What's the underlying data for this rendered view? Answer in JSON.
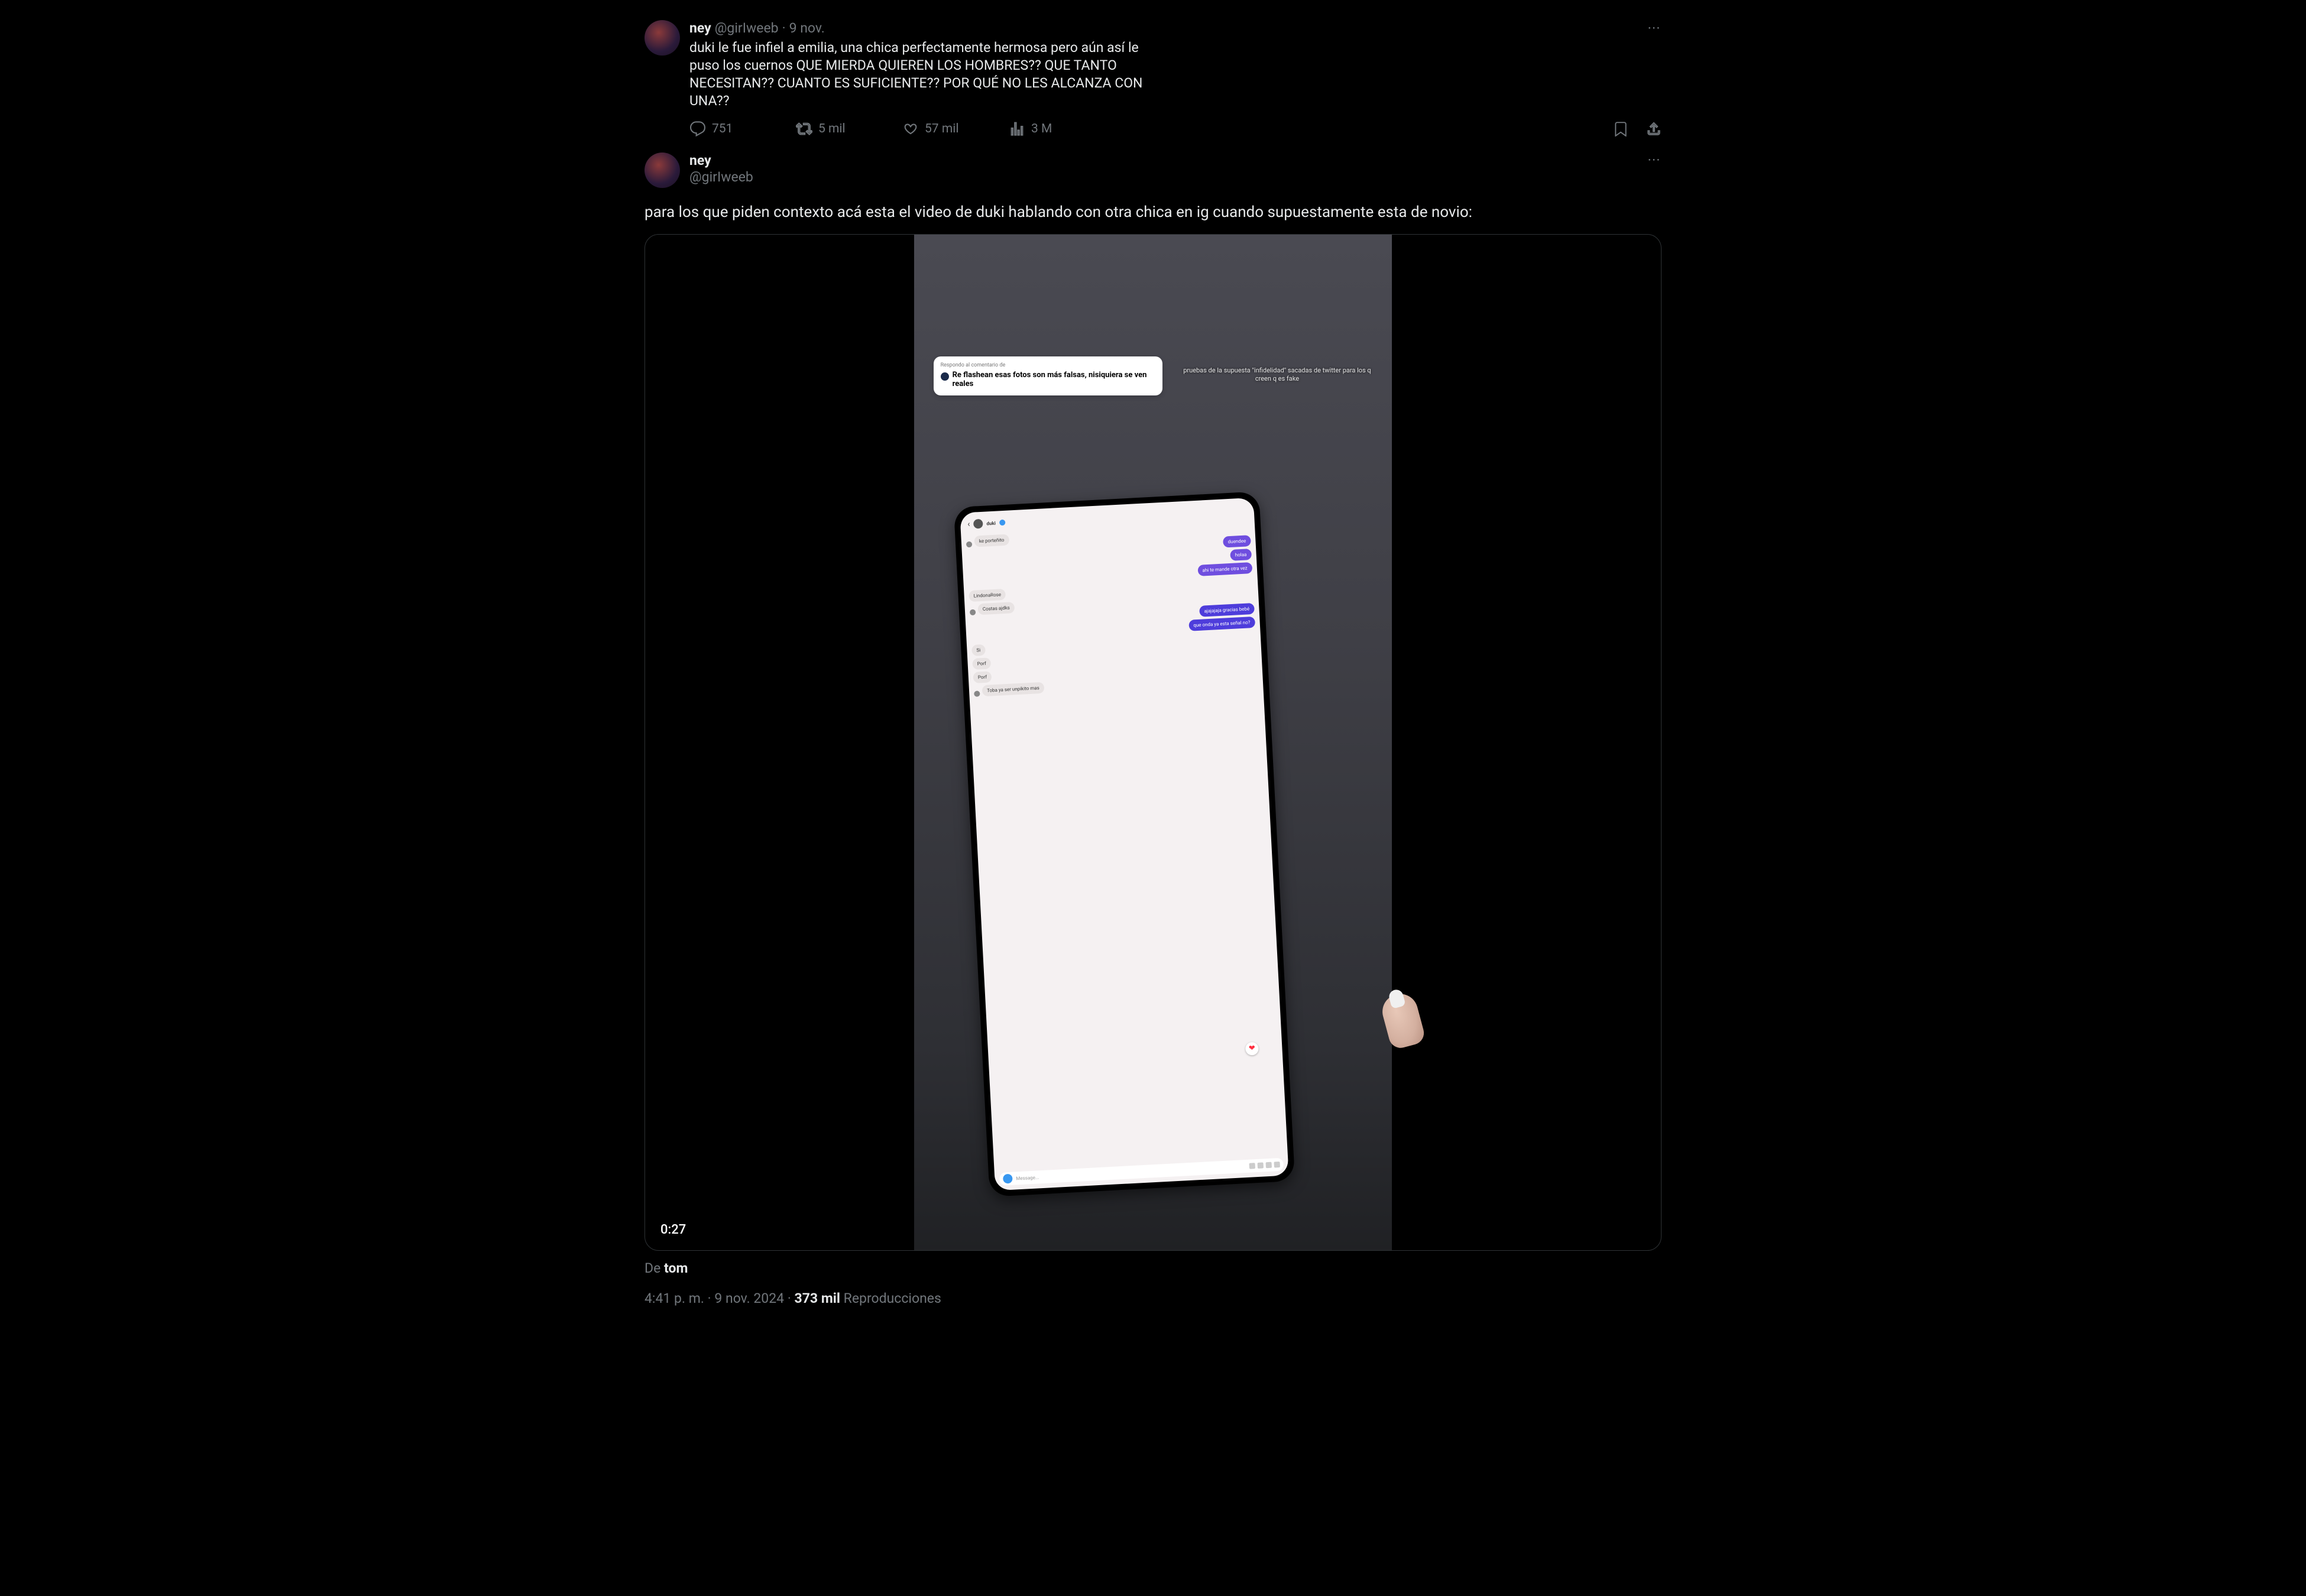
{
  "tweet1": {
    "displayName": "ney",
    "handle": "@girIweeb",
    "date": "9 nov.",
    "text": "duki le fue infiel a emilia, una chica perfectamente hermosa pero aún así le puso los cuernos QUE MIERDA QUIEREN LOS HOMBRES?? QUE TANTO NECESITAN?? CUANTO ES SUFICIENTE?? POR QUÉ NO LES ALCANZA CON UNA??",
    "replies": "751",
    "retweets": "5 mil",
    "likes": "57 mil",
    "views": "3 M"
  },
  "tweet2": {
    "displayName": "ney",
    "handle": "@girIweeb",
    "text": "para los que piden contexto acá esta el video de duki hablando con otra chica en ig cuando supuestamente esta de novio:",
    "videoDuration": "0:27",
    "attributionPrefix": "De ",
    "attributionName": "tom",
    "timestamp": "4:41 p. m. · 9 nov. 2024",
    "viewsCount": "373 mil",
    "viewsLabel": "Reproducciones"
  },
  "overlay": {
    "respondingTo": "Respondo al comentario de",
    "commentText": "Re flashean esas fotos son más falsas, nisiquiera se ven reales",
    "caption": "pruebas de la supuesta \"infidelidad\" sacadas de twitter para los q creen q es fake"
  },
  "phone": {
    "contactName": "duki",
    "messages": {
      "m1": "ke porteñito",
      "m2": "duendee",
      "m3": "holaa",
      "m4": "ahi te mande otra vez",
      "m5": "LindonaRose",
      "m6": "Costas ajdks",
      "m7": "ajajajaja gracias bebé",
      "m8": "que onda ya esta señal no?",
      "m9": "Si",
      "m10": "Porf",
      "m11": "Porf",
      "m12": "Toba ya ser unpikito mas"
    },
    "inputPlaceholder": "Message..."
  }
}
